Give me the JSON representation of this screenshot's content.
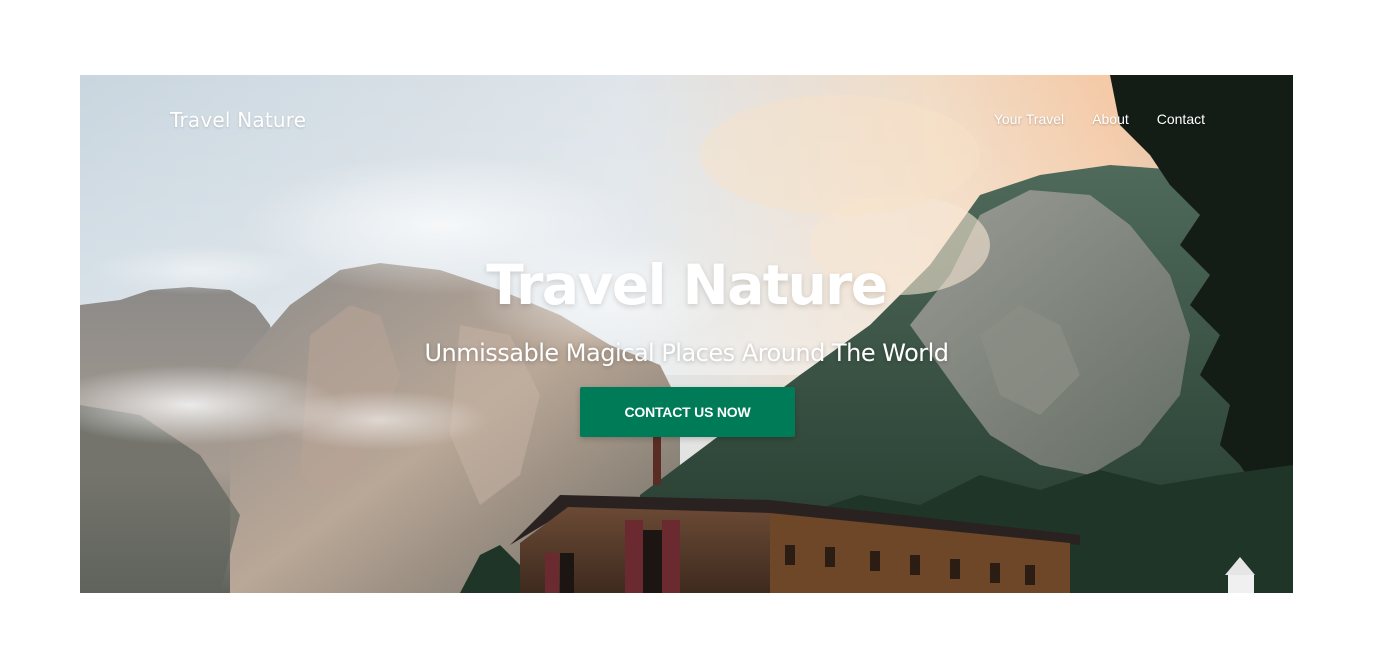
{
  "header": {
    "brand": "Travel Nature",
    "nav": [
      {
        "label": "Your Travel"
      },
      {
        "label": "About"
      },
      {
        "label": "Contact"
      }
    ]
  },
  "hero": {
    "title": "Travel Nature",
    "subtitle": "Unmissable Magical Places Around The World",
    "cta_label": "CONTACT US NOW",
    "image": "mountain-lake-cabin-photo"
  },
  "colors": {
    "cta_background": "#007b57",
    "text": "#ffffff",
    "page_background": "#ffffff"
  }
}
